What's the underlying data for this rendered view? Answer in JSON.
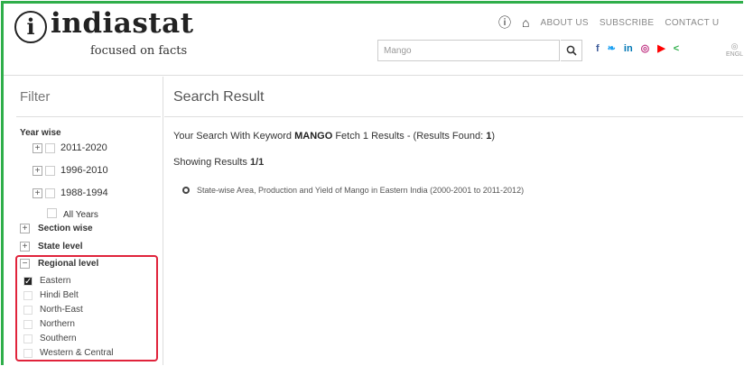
{
  "brand": {
    "logo_glyph": "i",
    "name": "indiastat",
    "tagline": "focused on facts"
  },
  "topnav": {
    "about": "ABOUT US",
    "subscribe": "SUBSCRIBE",
    "contact": "CONTACT U"
  },
  "search": {
    "value": "Mango"
  },
  "social": [
    {
      "name": "facebook-icon",
      "glyph": "f",
      "color": "#3b5998"
    },
    {
      "name": "twitter-icon",
      "glyph": "❧",
      "color": "#1da1f2"
    },
    {
      "name": "linkedin-icon",
      "glyph": "in",
      "color": "#0077b5"
    },
    {
      "name": "instagram-icon",
      "glyph": "◎",
      "color": "#c13584"
    },
    {
      "name": "youtube-icon",
      "glyph": "▶",
      "color": "#ff0000"
    },
    {
      "name": "share-icon",
      "glyph": "<",
      "color": "#2fae4a"
    }
  ],
  "lang": {
    "label": "ENGL"
  },
  "filter": {
    "title": "Filter",
    "year_wise": {
      "title": "Year wise",
      "items": [
        "2011-2020",
        "1996-2010",
        "1988-1994"
      ],
      "all_years": "All Years"
    },
    "section_wise": "Section wise",
    "state_level": "State level",
    "regional": {
      "title": "Regional level",
      "items": [
        {
          "label": "Eastern",
          "checked": true
        },
        {
          "label": "Hindi Belt",
          "checked": false
        },
        {
          "label": "North-East",
          "checked": false
        },
        {
          "label": "Northern",
          "checked": false
        },
        {
          "label": "Southern",
          "checked": false
        },
        {
          "label": "Western & Central",
          "checked": false
        }
      ]
    }
  },
  "main": {
    "title": "Search Result",
    "keyword_prefix": "Your Search With Keyword ",
    "keyword": "MANGO",
    "keyword_mid": " Fetch 1 Results - (Results Found: ",
    "found_count": "1",
    "keyword_suffix": ")",
    "showing_prefix": "Showing Results ",
    "showing_value": "1/1",
    "result_item": "State-wise Area, Production and Yield of Mango in Eastern India (2000-2001 to 2011-2012)"
  },
  "colors": {
    "frame_green": "#2fae4a",
    "highlight_red": "#e0233b"
  }
}
